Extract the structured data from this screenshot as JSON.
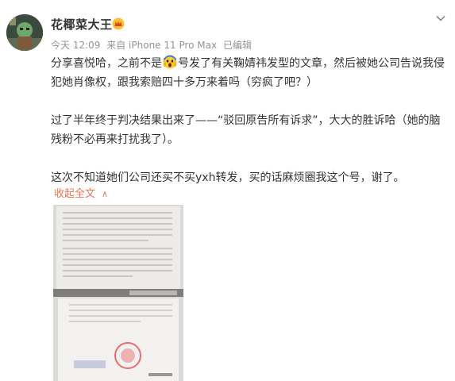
{
  "user": {
    "name": "花椰菜大王",
    "badge_icon": "vip-crown-icon"
  },
  "meta": {
    "time": "今天 12:09",
    "source": "来自 iPhone 11 Pro Max",
    "edited": "已编辑"
  },
  "post": {
    "p1_a": "分享喜悦哈，之前不是",
    "p1_emoji": "scream-face-emoji",
    "p1_b": "号发了有关鞠婧祎发型的文章，然后被她公司告说我侵犯她肖像权，跟我索赔四十多万来着吗（穷疯了吧？）",
    "p2": "过了半年终于判决结果出来了——“驳回原告所有诉求”，大大的胜诉哈（她的脑残粉不必再来打扰我了）。",
    "p3": "这次不知道她们公司还买不买yxh转发，买的话麻烦圈我这个号，谢了。"
  },
  "collapse_label": "收起全文",
  "collapse_icon": "chevron-up-icon",
  "more_icon": "chevron-down-icon",
  "colors": {
    "link": "#eb7350",
    "text": "#333333",
    "meta": "#939393"
  }
}
